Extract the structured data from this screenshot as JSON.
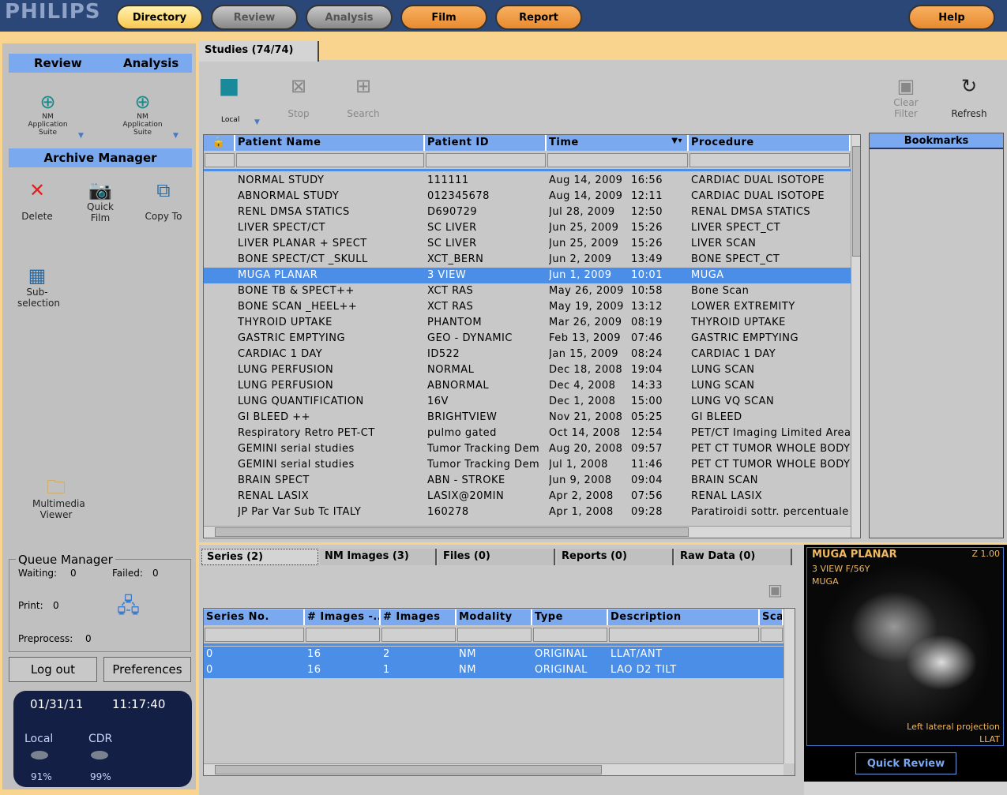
{
  "brand": "PHILIPS",
  "nav": [
    {
      "label": "Directory",
      "state": "active"
    },
    {
      "label": "Review",
      "state": "disabled"
    },
    {
      "label": "Analysis",
      "state": "disabled"
    },
    {
      "label": "Film",
      "state": "enabled"
    },
    {
      "label": "Report",
      "state": "enabled"
    },
    {
      "label": "Help",
      "state": "enabled"
    }
  ],
  "left": {
    "review_label": "Review",
    "analysis_label": "Analysis",
    "app1": "NM Application Suite",
    "app2": "NM Application Suite",
    "archive_title": "Archive Manager",
    "tools": [
      {
        "label": "Delete",
        "icon": "delete-x-icon"
      },
      {
        "label": "Quick Film",
        "icon": "camera-icon"
      },
      {
        "label": "Copy To",
        "icon": "copy-to-icon"
      },
      {
        "label": "Sub-selection",
        "icon": "subselection-icon"
      },
      {
        "label": "Multimedia Viewer",
        "icon": "multimedia-folder-icon"
      }
    ],
    "queue": {
      "title": "Queue Manager",
      "waiting_label": "Waiting:",
      "waiting": "0",
      "failed_label": "Failed:",
      "failed": "0",
      "print_label": "Print:",
      "print": "0",
      "preprocess_label": "Preprocess:",
      "preprocess": "0"
    },
    "logout": "Log out",
    "preferences": "Preferences",
    "status": {
      "date": "01/31/11",
      "time": "11:17:40",
      "local_label": "Local",
      "local_pct": "91%",
      "cdr_label": "CDR",
      "cdr_pct": "99%"
    }
  },
  "studies": {
    "tab": "Studies (74/74)",
    "source": "Local",
    "stop": "Stop",
    "search": "Search",
    "clear_filter": "Clear Filter",
    "refresh": "Refresh",
    "bookmarks": "Bookmarks",
    "columns": [
      "Patient Name",
      "Patient ID",
      "Time",
      "Procedure"
    ],
    "selected_index": 6,
    "rows": [
      [
        "NORMAL STUDY",
        "111111",
        "Aug 14, 2009",
        "16:56",
        "CARDIAC DUAL ISOTOPE"
      ],
      [
        "ABNORMAL STUDY",
        "012345678",
        "Aug 14, 2009",
        "12:11",
        "CARDIAC DUAL ISOTOPE"
      ],
      [
        "RENL DMSA STATICS",
        "D690729",
        "Jul 28, 2009",
        "12:50",
        "RENAL DMSA STATICS"
      ],
      [
        "LIVER SPECT/CT",
        "SC LIVER",
        "Jun 25, 2009",
        "15:26",
        "LIVER SPECT_CT"
      ],
      [
        "LIVER PLANAR + SPECT",
        "SC LIVER",
        "Jun 25, 2009",
        "15:26",
        "LIVER SCAN"
      ],
      [
        "BONE SPECT/CT _SKULL",
        "XCT_BERN",
        "Jun 2, 2009",
        "13:49",
        "BONE SPECT_CT"
      ],
      [
        "MUGA PLANAR",
        "3 VIEW",
        "Jun 1, 2009",
        "10:01",
        "MUGA"
      ],
      [
        "BONE TB & SPECT++",
        "XCT RAS",
        "May 26, 2009",
        "10:58",
        "Bone Scan"
      ],
      [
        "BONE SCAN _HEEL++",
        "XCT RAS",
        "May 19, 2009",
        "13:12",
        "LOWER EXTREMITY"
      ],
      [
        "THYROID UPTAKE",
        "PHANTOM",
        "Mar 26, 2009",
        "08:19",
        "THYROID UPTAKE"
      ],
      [
        "GASTRIC EMPTYING",
        "GEO - DYNAMIC",
        "Feb 13, 2009",
        "07:46",
        "GASTRIC EMPTYING"
      ],
      [
        "CARDIAC 1 DAY",
        "ID522",
        "Jan 15, 2009",
        "08:24",
        "CARDIAC 1 DAY"
      ],
      [
        "LUNG PERFUSION",
        "NORMAL",
        "Dec 18, 2008",
        "19:04",
        "LUNG SCAN"
      ],
      [
        "LUNG PERFUSION",
        "ABNORMAL",
        "Dec 4, 2008",
        "14:33",
        "LUNG SCAN"
      ],
      [
        "LUNG QUANTIFICATION",
        "16V",
        "Dec 1, 2008",
        "15:00",
        "LUNG VQ SCAN"
      ],
      [
        "GI BLEED ++",
        "BRIGHTVIEW",
        "Nov 21, 2008",
        "05:25",
        "GI BLEED"
      ],
      [
        "Respiratory Retro PET-CT",
        "pulmo gated",
        "Oct 14, 2008",
        "12:54",
        "PET/CT Imaging  Limited Area"
      ],
      [
        "GEMINI serial studies",
        "Tumor Tracking Dem",
        "Aug 20, 2008",
        "09:57",
        "PET CT TUMOR WHOLE BODY"
      ],
      [
        "GEMINI serial studies",
        "Tumor Tracking Dem",
        "Jul 1, 2008",
        "11:46",
        "PET CT TUMOR WHOLE BODY"
      ],
      [
        "BRAIN SPECT",
        "ABN - STROKE",
        "Jun 9, 2008",
        "09:04",
        "BRAIN SCAN"
      ],
      [
        "RENAL LASIX",
        "LASIX@20MIN",
        "Apr 2, 2008",
        "07:56",
        "RENAL LASIX"
      ],
      [
        "JP Par Var Sub Tc ITALY",
        "160278",
        "Apr 1, 2008",
        "09:28",
        "Paratiroidi sottr. percentuale"
      ]
    ]
  },
  "series": {
    "tabs": [
      "Series (2)",
      "NM Images (3)",
      "Files (0)",
      "Reports (0)",
      "Raw Data (0)"
    ],
    "columns": [
      "Series No.",
      "# Images -...",
      "# Images",
      "Modality",
      "Type",
      "Description",
      "Scan"
    ],
    "rows": [
      [
        "0",
        "16",
        "2",
        "NM",
        "ORIGINAL",
        "LLAT/ANT"
      ],
      [
        "0",
        "16",
        "1",
        "NM",
        "ORIGINAL",
        "LAO D2 TILT"
      ]
    ]
  },
  "preview": {
    "title": "MUGA PLANAR",
    "line2": "3 VIEW F/56Y",
    "line3": "MUGA",
    "zoom": "Z 1.00",
    "caption": "Left lateral projection",
    "view": "LLAT",
    "button": "Quick Review"
  },
  "colors": {
    "header_blue": "#7ba9f0",
    "selection": "#4a8ee8",
    "topbar": "#2b4777",
    "background": "#f8d48e",
    "overlay_text": "#f0b860"
  }
}
